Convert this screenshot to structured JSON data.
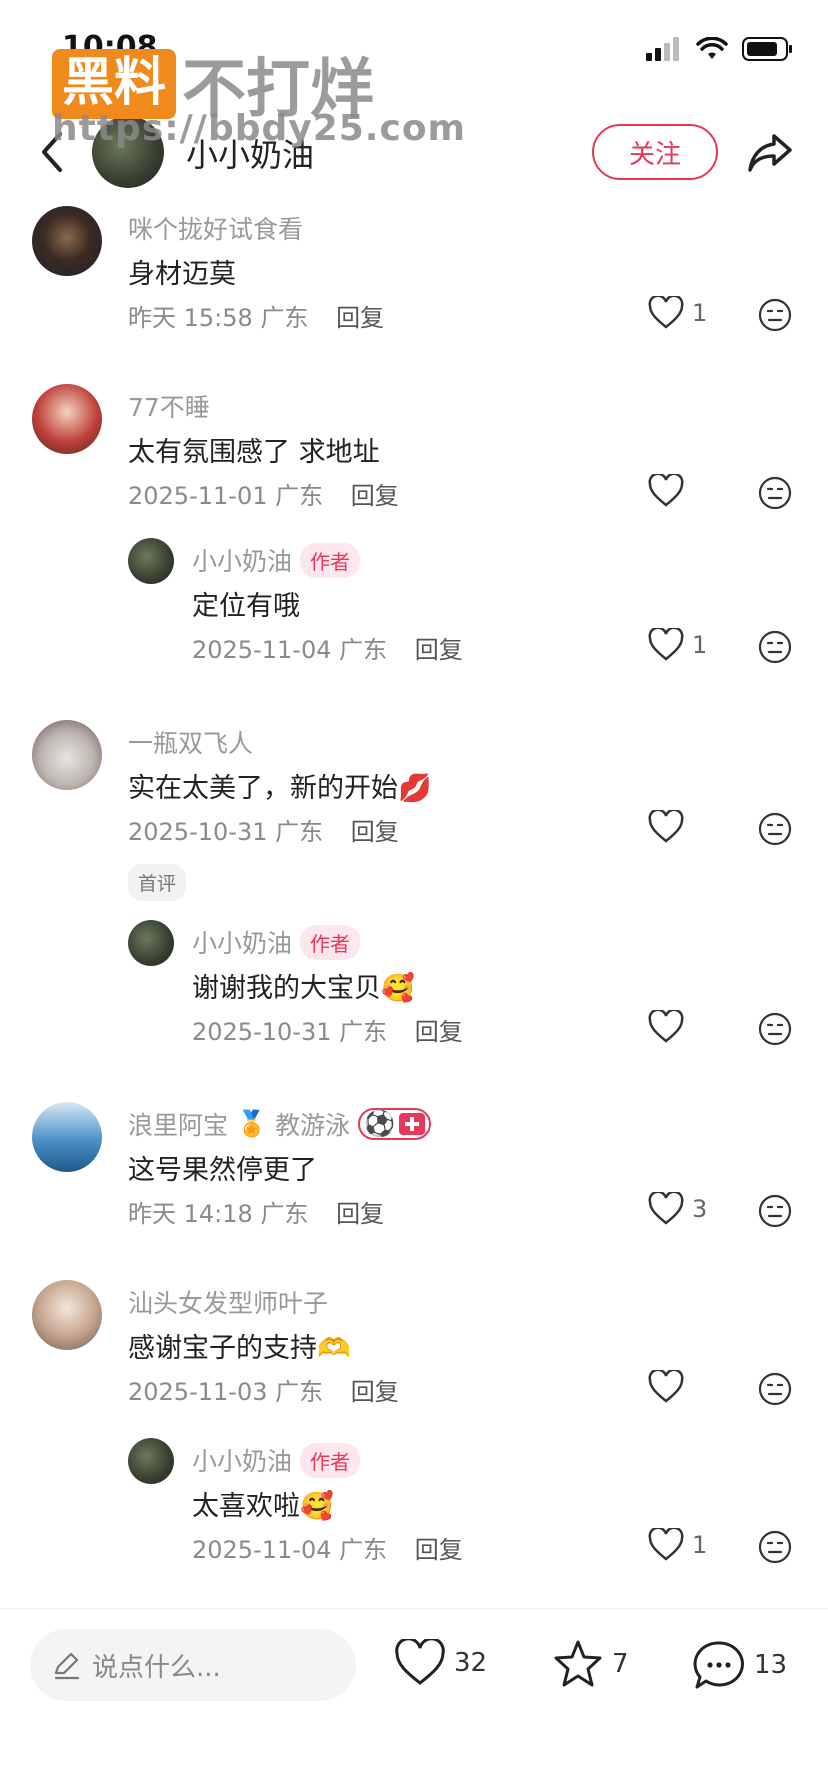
{
  "status_bar": {
    "time": "10:08"
  },
  "watermark": {
    "box_text": "黑料",
    "text": "不打烊",
    "url": "https://bbdy25.com"
  },
  "header": {
    "username": "小小奶油",
    "follow_label": "关注"
  },
  "comments": [
    {
      "name": "咪个拢好试食看",
      "text": "身材迈莫",
      "date": "昨天 15:58",
      "region": "广东",
      "reply": "回复",
      "likes": "1"
    },
    {
      "name": "77不睡",
      "text": "太有氛围感了 求地址",
      "date": "2025-11-01",
      "region": "广东",
      "reply": "回复",
      "likes": ""
    },
    {
      "name": "小小奶油",
      "tag": "作者",
      "text": "定位有哦",
      "date": "2025-11-04",
      "region": "广东",
      "reply": "回复",
      "likes": "1"
    },
    {
      "name": "一瓶双飞人",
      "text": "实在太美了，新的开始💋",
      "date": "2025-10-31",
      "region": "广东",
      "reply": "回复",
      "likes": "",
      "first_tag": "首评"
    },
    {
      "name": "小小奶油",
      "tag": "作者",
      "text": "谢谢我的大宝贝🥰",
      "date": "2025-10-31",
      "region": "广东",
      "reply": "回复",
      "likes": ""
    },
    {
      "name": "浪里阿宝",
      "badge_medal": "🏅",
      "title": "教游泳",
      "badge_ball": "⚽",
      "text": "这号果然停更了",
      "date": "昨天 14:18",
      "region": "广东",
      "reply": "回复",
      "likes": "3"
    },
    {
      "name": "汕头女发型师叶子",
      "text": "感谢宝子的支持🫶",
      "date": "2025-11-03",
      "region": "广东",
      "reply": "回复",
      "likes": ""
    },
    {
      "name": "小小奶油",
      "tag": "作者",
      "text": "太喜欢啦🥰",
      "date": "2025-11-04",
      "region": "广东",
      "reply": "回复",
      "likes": "1"
    }
  ],
  "bottom_bar": {
    "placeholder": "说点什么...",
    "likes": "32",
    "favorites": "7",
    "comments": "13"
  },
  "colors": {
    "accent": "#e8375a",
    "watermark_orange": "#f08a1c"
  }
}
